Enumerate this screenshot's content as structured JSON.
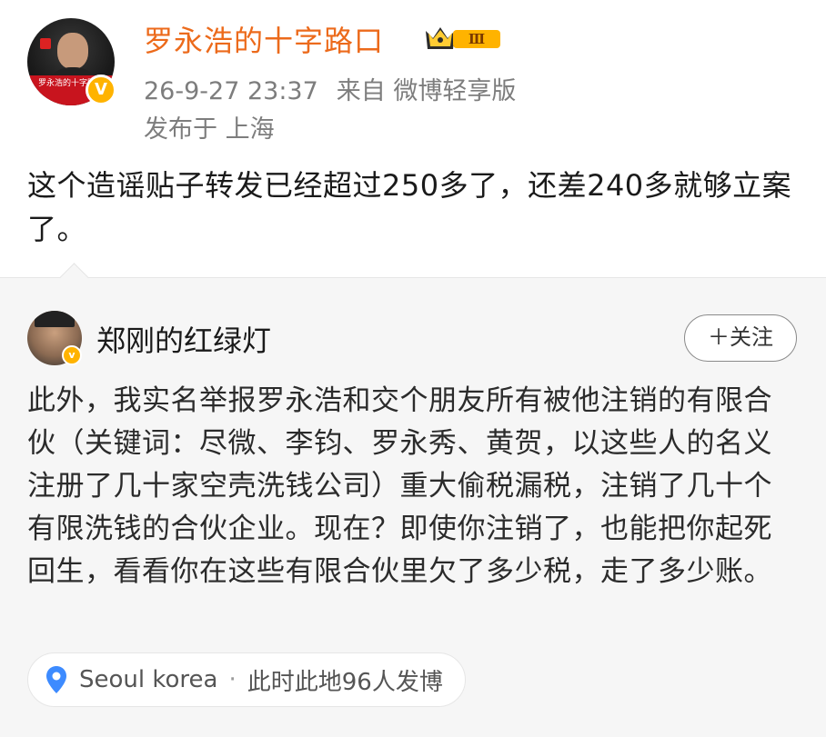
{
  "post": {
    "author": "罗永浩的十字路口",
    "vip_level": "Ⅲ",
    "time": "26-9-27 23:37",
    "source": "来自 微博轻享版",
    "location": "发布于 上海",
    "text": "这个造谣贴子转发已经超过250多了，还差240多就够立案了。",
    "avatar_caption": "罗永浩的十字路口",
    "colors": {
      "author_name": "#ec6a1b",
      "meta": "#7d7d7d",
      "badge": "#ffb300"
    }
  },
  "repost": {
    "author": "郑刚的红绿灯",
    "follow_label": "＋关注",
    "text": "此外，我实名举报罗永浩和交个朋友所有被他注销的有限合伙（关键词：尽微、李钧、罗永秀、黄贺，以这些人的名义注册了几十家空壳洗钱公司）重大偷税漏税，注销了几十个有限洗钱的合伙企业。现在？即使你注销了，也能把你起死回生，看看你在这些有限合伙里欠了多少税，走了多少账。",
    "place": "Seoul korea",
    "place_sep": "·",
    "place_stat": "此时此地96人发博",
    "colors": {
      "background": "#f6f6f6",
      "pin": "#3d8bff"
    }
  },
  "icons": [
    "v-badge-icon",
    "crown-icon",
    "location-pin-icon"
  ]
}
